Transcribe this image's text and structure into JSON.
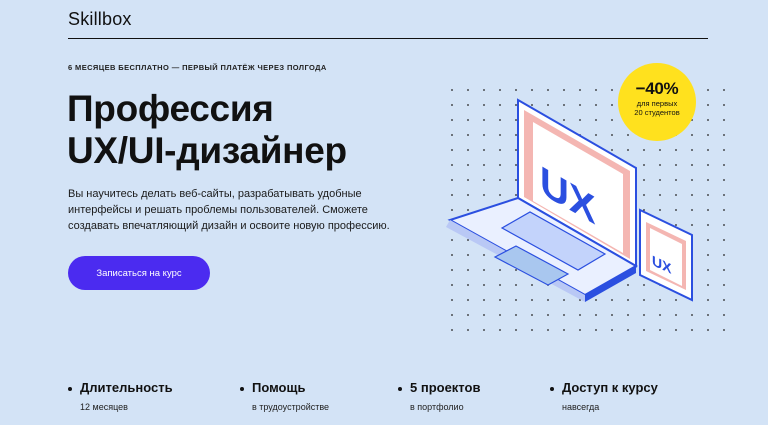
{
  "header": {
    "logo": "Skillbox"
  },
  "hero": {
    "eyebrow": "6 месяцев бесплатно — первый платёж через полгода",
    "title_line1": "Профессия",
    "title_line2": "UX/UI-дизайнер",
    "desc_line1": "Вы научитесь делать веб-сайты, разрабатывать удобные",
    "desc_line2": "интерфейсы и решать проблемы пользователей. Сможете",
    "desc_line3": "создавать впечатляющий дизайн и освоите новую профессию.",
    "cta_label": "Записаться на курс",
    "laptop_screen_text": "UX",
    "phone_screen_text": "UX"
  },
  "badge": {
    "percent": "−40%",
    "line1": "для первых",
    "line2": "20 студентов",
    "color": "#ffe11e"
  },
  "facts": [
    {
      "title": "Длительность",
      "sub": "12 месяцев"
    },
    {
      "title": "Помощь",
      "sub": "в трудоустройстве"
    },
    {
      "title": "5 проектов",
      "sub": "в портфолио"
    },
    {
      "title": "Доступ к курсу",
      "sub": "навсегда"
    }
  ],
  "colors": {
    "background": "#d3e3f6",
    "accent": "#4b2bf0",
    "illustration_blue": "#2b4fe0",
    "illustration_pink": "#f4b6b2"
  }
}
